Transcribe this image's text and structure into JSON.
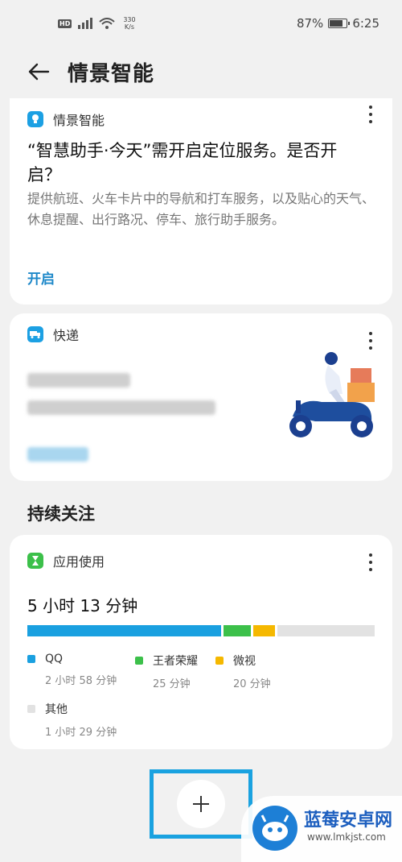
{
  "status_bar": {
    "net_speed_top": "330",
    "net_speed_unit": "K/s",
    "hd": "HD",
    "battery": "87%",
    "time": "6:25"
  },
  "appbar": {
    "title": "情景智能"
  },
  "card_location": {
    "title": "情景智能",
    "heading": "“智慧助手·今天”需开启定位服务。是否开启？",
    "description": "提供航班、火车卡片中的导航和打车服务，以及贴心的天气、休息提醒、出行路况、停车、旅行助手服务。",
    "action": "开启"
  },
  "card_express": {
    "title": "快递"
  },
  "section": {
    "title": "持续关注"
  },
  "card_usage": {
    "title": "应用使用",
    "total": "5 小时 13 分钟",
    "apps": [
      {
        "name": "QQ",
        "time": "2 小时 58 分钟",
        "color": "#1aa0e0",
        "fraction": 0.57
      },
      {
        "name": "王者荣耀",
        "time": "25 分钟",
        "color": "#3cc04a",
        "fraction": 0.08
      },
      {
        "name": "微视",
        "time": "20 分钟",
        "color": "#f5b800",
        "fraction": 0.064
      },
      {
        "name": "其他",
        "time": "1 小时 29 分钟",
        "color": "#e2e2e2",
        "fraction": 0.286
      }
    ]
  },
  "watermark": {
    "title": "蓝莓安卓网",
    "url": "www.lmkjst.com"
  }
}
